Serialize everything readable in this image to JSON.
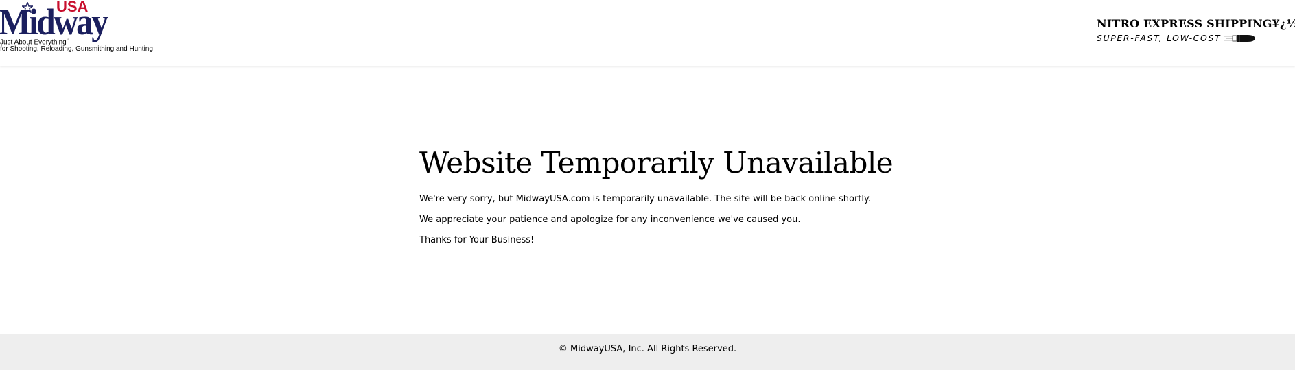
{
  "header": {
    "logo": {
      "brand": "Midway",
      "brand_suffix": "USA",
      "registered_mark": "®",
      "tagline_line1": "Just About Everything",
      "tagline_mark": "℠",
      "tagline_line2": "for Shooting, Reloading, Gunsmithing and Hunting",
      "colors": {
        "brand_blue": "#1b1f5e",
        "brand_red": "#c8102e"
      },
      "icon": "star-icon"
    },
    "promo": {
      "title": "NITRO EXPRESS SHIPPING¥¿½",
      "subtitle": "SUPER-FAST, LOW-COST",
      "icon": "bullet-icon"
    }
  },
  "main": {
    "heading": "Website Temporarily Unavailable",
    "paragraphs": [
      "We're very sorry, but MidwayUSA.com is temporarily unavailable. The site will be back online shortly.",
      "We appreciate your patience and apologize for any inconvenience we've caused you.",
      "Thanks for Your Business!"
    ]
  },
  "footer": {
    "copyright": "© MidwayUSA, Inc. All Rights Reserved."
  }
}
